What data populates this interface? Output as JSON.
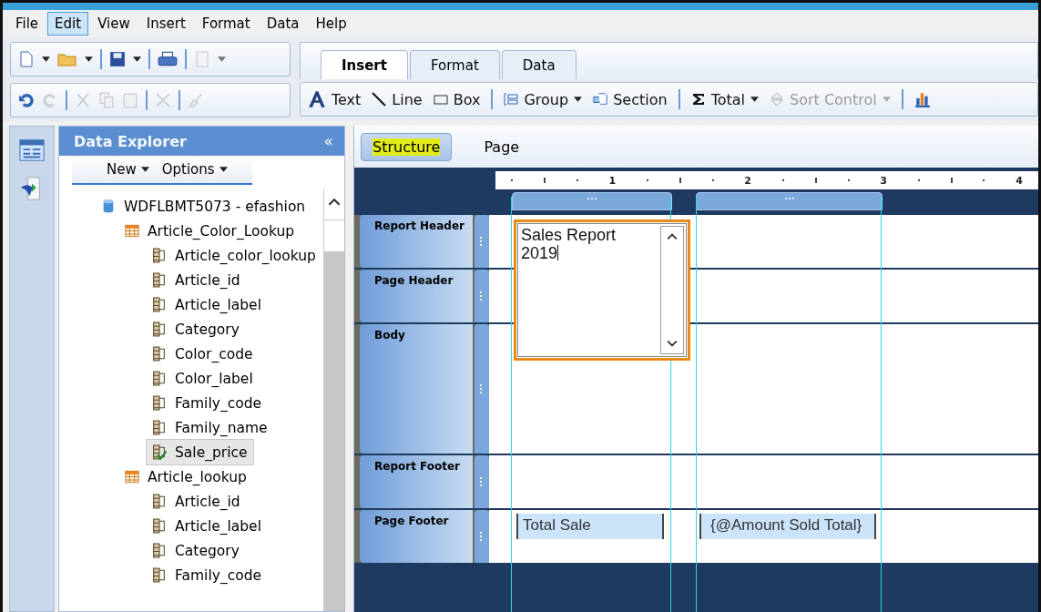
{
  "menu": [
    {
      "label": "File",
      "selected": false
    },
    {
      "label": "Edit",
      "selected": true
    },
    {
      "label": "View",
      "selected": false
    },
    {
      "label": "Insert",
      "selected": false
    },
    {
      "label": "Format",
      "selected": false
    },
    {
      "label": "Data",
      "selected": false
    },
    {
      "label": "Help",
      "selected": false
    }
  ],
  "tabs": [
    {
      "label": "Insert",
      "selected": true
    },
    {
      "label": "Format",
      "selected": false
    },
    {
      "label": "Data",
      "selected": false
    }
  ],
  "insert_tools": [
    {
      "kind": "text",
      "label": "Text",
      "disabled": false,
      "dropdown": false
    },
    {
      "kind": "line",
      "label": "Line",
      "disabled": false,
      "dropdown": false
    },
    {
      "kind": "box",
      "label": "Box",
      "disabled": false,
      "dropdown": false
    },
    {
      "kind": "group",
      "label": "Group",
      "disabled": false,
      "dropdown": true
    },
    {
      "kind": "section",
      "label": "Section",
      "disabled": false,
      "dropdown": false
    },
    {
      "kind": "total",
      "label": "Total",
      "disabled": false,
      "dropdown": true
    },
    {
      "kind": "sort",
      "label": "Sort Control",
      "disabled": true,
      "dropdown": true
    },
    {
      "kind": "chart",
      "disabled": false
    }
  ],
  "data_explorer": {
    "title": "Data Explorer",
    "collapse": "«",
    "menu": [
      "New",
      "Options"
    ],
    "tree": [
      {
        "kind": "database",
        "label": "WDFLBMT5073 - efashion",
        "selected": false,
        "children": [
          {
            "kind": "table",
            "label": "Article_Color_Lookup",
            "selected": false,
            "children": [
              {
                "kind": "field",
                "label": "Article_color_lookup",
                "selected": false
              },
              {
                "kind": "field",
                "label": "Article_id",
                "selected": false
              },
              {
                "kind": "field",
                "label": "Article_label",
                "selected": false
              },
              {
                "kind": "field",
                "label": "Category",
                "selected": false
              },
              {
                "kind": "field",
                "label": "Color_code",
                "selected": false
              },
              {
                "kind": "field",
                "label": "Color_label",
                "selected": false
              },
              {
                "kind": "field",
                "label": "Family_code",
                "selected": false
              },
              {
                "kind": "field",
                "label": "Family_name",
                "selected": false
              },
              {
                "kind": "field",
                "label": "Sale_price",
                "selected": true
              }
            ]
          },
          {
            "kind": "table",
            "label": "Article_lookup",
            "selected": false,
            "children": [
              {
                "kind": "field",
                "label": "Article_id",
                "selected": false
              },
              {
                "kind": "field",
                "label": "Article_label",
                "selected": false
              },
              {
                "kind": "field",
                "label": "Category",
                "selected": false
              },
              {
                "kind": "field",
                "label": "Family_code",
                "selected": false
              }
            ]
          }
        ]
      }
    ]
  },
  "view_tabs": [
    {
      "label": "Structure",
      "selected": true
    },
    {
      "label": "Page",
      "selected": false
    }
  ],
  "ruler": [
    "1",
    "2",
    "3",
    "4"
  ],
  "sections": [
    {
      "name": "Report Header"
    },
    {
      "name": "Page Header"
    },
    {
      "name": "Body"
    },
    {
      "name": "Report Footer"
    },
    {
      "name": "Page Footer"
    }
  ],
  "text_box": {
    "lines": [
      "Sales Report",
      "2019"
    ]
  },
  "footer_fields": [
    "Total Sale",
    "{@Amount Sold Total}"
  ]
}
